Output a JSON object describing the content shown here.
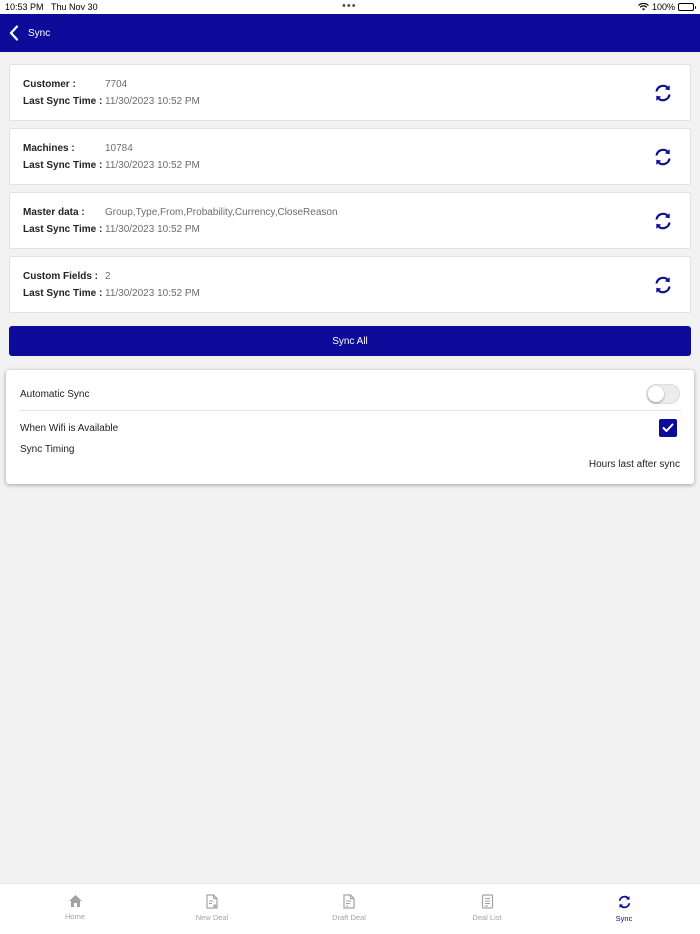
{
  "status_bar": {
    "time": "10:53 PM",
    "date": "Thu Nov 30",
    "battery": "100%",
    "battery_level": 1.0
  },
  "nav": {
    "title": "Sync",
    "back_icon": "chevron-left-icon"
  },
  "cards": [
    {
      "label": "Customer :",
      "value": "7704",
      "time_label": "Last Sync Time :",
      "time": "11/30/2023 10:52 PM"
    },
    {
      "label": "Machines :",
      "value": "10784",
      "time_label": "Last Sync Time :",
      "time": "11/30/2023 10:52 PM"
    },
    {
      "label": "Master data :",
      "value": "Group,Type,From,Probability,Currency,CloseReason",
      "time_label": "Last Sync Time :",
      "time": "11/30/2023 10:52 PM"
    },
    {
      "label": "Custom Fields :",
      "value": "2",
      "time_label": "Last Sync Time :",
      "time": "11/30/2023 10:52 PM"
    }
  ],
  "sync_all_label": "Sync All",
  "settings": {
    "automatic_sync_label": "Automatic Sync",
    "automatic_sync_on": false,
    "wifi_label": "When Wifi is Available",
    "wifi_checked": true,
    "timing_label": "Sync Timing",
    "hours_label": "Hours last after sync"
  },
  "tabs": [
    {
      "label": "Home",
      "icon": "home-icon",
      "active": false
    },
    {
      "label": "New Deal",
      "icon": "new-document-icon",
      "active": false
    },
    {
      "label": "Draft Deal",
      "icon": "draft-document-icon",
      "active": false
    },
    {
      "label": "Deal List",
      "icon": "list-document-icon",
      "active": false
    },
    {
      "label": "Sync",
      "icon": "sync-icon",
      "active": true
    }
  ],
  "colors": {
    "primary": "#0d0c9a",
    "background": "#f2f2f3",
    "muted": "#a3a3a3"
  }
}
